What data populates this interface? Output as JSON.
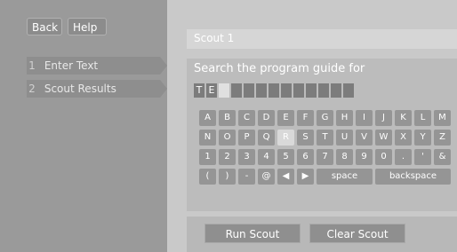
{
  "topbar": {
    "back_label": "Back",
    "help_label": "Help"
  },
  "nav": [
    {
      "num": "1",
      "label": "Enter Text"
    },
    {
      "num": "2",
      "label": "Scout Results"
    }
  ],
  "title": "Scout 1",
  "prompt": "Search the program guide for",
  "entry": [
    "T",
    "E",
    "",
    "",
    "",
    "",
    "",
    "",
    "",
    "",
    "",
    "",
    ""
  ],
  "keyboard": {
    "rows": [
      [
        "A",
        "B",
        "C",
        "D",
        "E",
        "F",
        "G",
        "H",
        "I",
        "J",
        "K",
        "L",
        "M"
      ],
      [
        "N",
        "O",
        "P",
        "Q",
        "R",
        "S",
        "T",
        "U",
        "V",
        "W",
        "X",
        "Y",
        "Z"
      ],
      [
        "1",
        "2",
        "3",
        "4",
        "5",
        "6",
        "7",
        "8",
        "9",
        "0",
        ".",
        "'",
        "&"
      ],
      [
        "(",
        ")",
        "-",
        "@",
        "◀",
        "▶",
        "space",
        "backspace"
      ]
    ],
    "highlighted": "R"
  },
  "actions": {
    "run_label": "Run Scout",
    "clear_label": "Clear Scout"
  }
}
